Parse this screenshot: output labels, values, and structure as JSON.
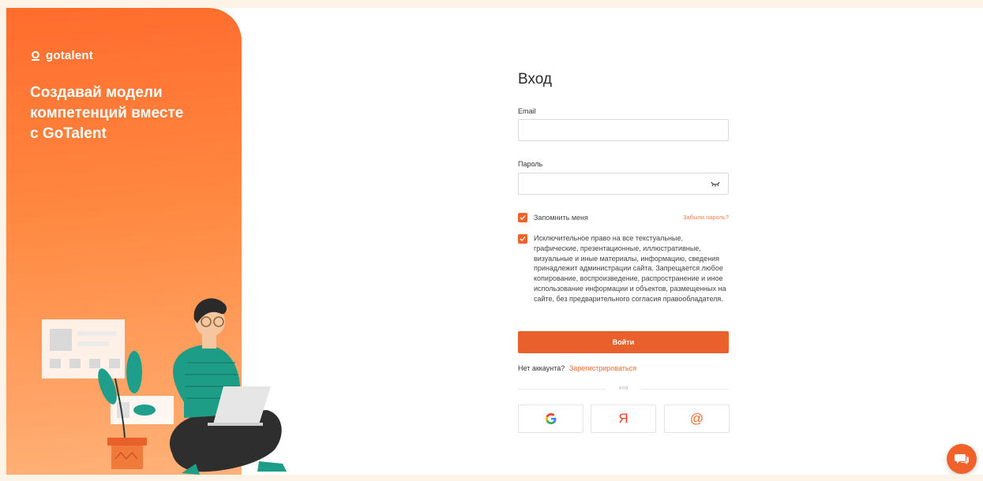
{
  "brand": {
    "name": "gotalent",
    "tagline": "Создавай модели\nкомпетенций вместе\nс GoTalent"
  },
  "login": {
    "title": "Вход",
    "email_label": "Email",
    "email_value": "",
    "password_label": "Пароль",
    "password_value": "",
    "remember_label": "Запомнить меня",
    "remember_checked": true,
    "forgot_label": "Забыли пароль?",
    "copyright_text": "Исключительное право на все текстуальные, графические, презентационные, иллюстративные, визуальные и иные материалы, информацию, сведения принадлежит администрации сайта. Запрещается любое копирование, воспроизведение, распространение и иное использование информации и объектов, размещенных на сайте, без предварительного согласия правообладателя.",
    "copyright_checked": true,
    "submit_label": "Войти",
    "no_account_label": "Нет аккаунта?",
    "register_label": "Зарегистрироваться",
    "divider_label": "или"
  },
  "social": [
    {
      "name": "google",
      "icon": "google-icon",
      "glyph": "G",
      "color": "#4285f4"
    },
    {
      "name": "yandex",
      "icon": "yandex-icon",
      "glyph": "Я",
      "color": "#fc3f1d"
    },
    {
      "name": "mailru",
      "icon": "mailru-icon",
      "glyph": "@",
      "color": "#f26a2e"
    }
  ],
  "colors": {
    "accent": "#e9602a",
    "promo_start": "#ff6c2c",
    "promo_end": "#ffb27a",
    "link": "#f06a35"
  },
  "chat": {
    "icon": "chat-icon"
  }
}
